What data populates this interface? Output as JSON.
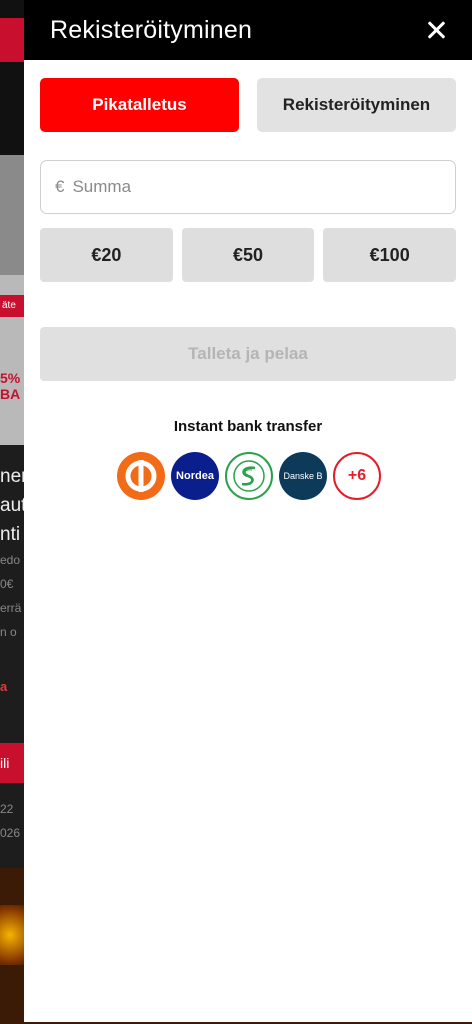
{
  "background": {
    "promo_tag": "äte",
    "promo_text": "5%\nBA",
    "heading": "ner\naut\nnti",
    "meta": "edo\n0€\nerrä\nn o",
    "link": "a",
    "button": "ili",
    "meta2": "22\n026",
    "game_text": "ro"
  },
  "drawer": {
    "title": "Rekisteröityminen",
    "close_icon": "close-icon"
  },
  "tabs": [
    {
      "label": "Pikatalletus",
      "active": true
    },
    {
      "label": "Rekisteröityminen",
      "active": false
    }
  ],
  "amount": {
    "currency_symbol": "€",
    "placeholder": "Summa",
    "value": ""
  },
  "presets": [
    "€20",
    "€50",
    "€100"
  ],
  "submit": {
    "label": "Talleta ja pelaa",
    "disabled": true
  },
  "banks": {
    "label": "Instant bank transfer",
    "items": [
      {
        "name": "OP",
        "icon": "op-bank-icon",
        "text": ""
      },
      {
        "name": "Nordea",
        "icon": "nordea-icon",
        "text": "Nordea"
      },
      {
        "name": "S-Pankki",
        "icon": "s-pankki-icon",
        "text": ""
      },
      {
        "name": "Danske Bank",
        "icon": "danske-bank-icon",
        "text": "Danske B"
      },
      {
        "name": "More",
        "icon": "more-banks-badge",
        "text": "+6"
      }
    ]
  },
  "colors": {
    "accent_red": "#ff0000",
    "header_black": "#000000",
    "disabled_grey": "#e0e0e0"
  }
}
